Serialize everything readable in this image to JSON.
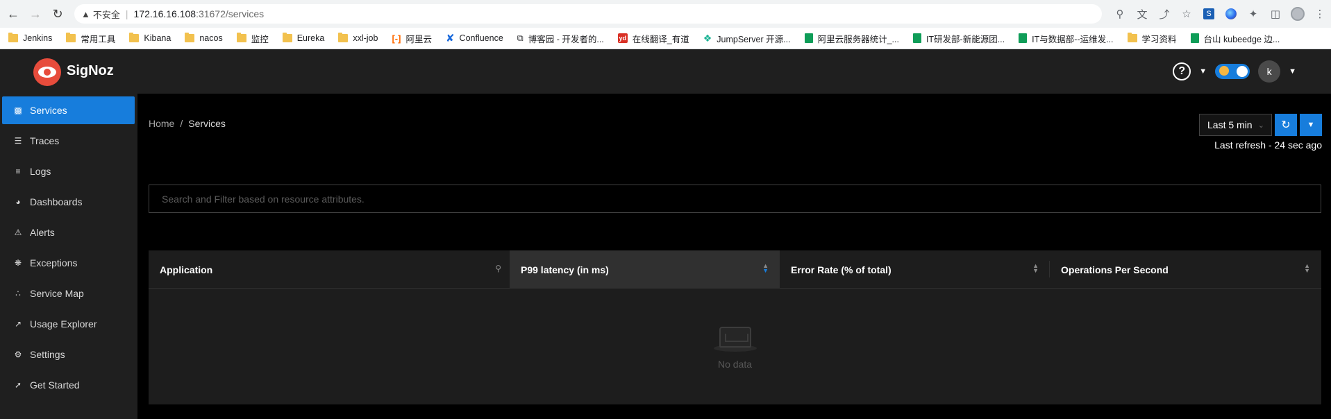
{
  "browser": {
    "address": {
      "warning": "不安全",
      "host": "172.16.16.108",
      "path": ":31672/services"
    },
    "bookmarks": [
      {
        "label": "Jenkins",
        "icon": "folder-icon"
      },
      {
        "label": "常用工具",
        "icon": "folder-icon"
      },
      {
        "label": "Kibana",
        "icon": "folder-icon"
      },
      {
        "label": "nacos",
        "icon": "folder-icon"
      },
      {
        "label": "监控",
        "icon": "folder-icon"
      },
      {
        "label": "Eureka",
        "icon": "folder-icon"
      },
      {
        "label": "xxl-job",
        "icon": "folder-icon"
      },
      {
        "label": "阿里云",
        "icon": "aliyun-icon"
      },
      {
        "label": "Confluence",
        "icon": "confluence-icon"
      },
      {
        "label": "博客园 - 开发者的...",
        "icon": "cnblogs-icon"
      },
      {
        "label": "在线翻译_有道",
        "icon": "youdao-icon"
      },
      {
        "label": "JumpServer 开源...",
        "icon": "jumpserver-icon"
      },
      {
        "label": "阿里云服务器统计_...",
        "icon": "sheet-icon"
      },
      {
        "label": "IT研发部-新能源团...",
        "icon": "sheet-icon"
      },
      {
        "label": "IT与数据部--运维发...",
        "icon": "sheet-icon"
      },
      {
        "label": "学习资料",
        "icon": "folder-icon"
      },
      {
        "label": "台山 kubeedge 边...",
        "icon": "sheet-icon"
      }
    ]
  },
  "app": {
    "brand": "SigNoz",
    "avatar_letter": "k",
    "help_symbol": "?"
  },
  "sidebar": {
    "items": [
      {
        "label": "Services",
        "icon": "bar-chart-icon",
        "active": true
      },
      {
        "label": "Traces",
        "icon": "list-icon"
      },
      {
        "label": "Logs",
        "icon": "logs-icon"
      },
      {
        "label": "Dashboards",
        "icon": "dashboard-icon"
      },
      {
        "label": "Alerts",
        "icon": "alarm-icon"
      },
      {
        "label": "Exceptions",
        "icon": "bug-icon"
      },
      {
        "label": "Service Map",
        "icon": "deployment-unit-icon"
      },
      {
        "label": "Usage Explorer",
        "icon": "line-chart-icon"
      },
      {
        "label": "Settings",
        "icon": "settings-icon"
      },
      {
        "label": "Get Started",
        "icon": "rocket-icon"
      }
    ]
  },
  "main": {
    "breadcrumb": {
      "home": "Home",
      "separator": "/",
      "current": "Services"
    },
    "time_range": {
      "selected": "Last 5 min"
    },
    "last_refresh": "Last refresh - 24 sec ago",
    "search": {
      "placeholder": "Search and Filter based on resource attributes."
    },
    "table": {
      "columns": [
        {
          "label": "Application"
        },
        {
          "label": "P99 latency (in ms)"
        },
        {
          "label": "Error Rate (% of total)"
        },
        {
          "label": "Operations Per Second"
        }
      ],
      "empty_text": "No data"
    }
  },
  "colors": {
    "accent": "#177ddc",
    "brand_logo": "#e74c3c"
  }
}
